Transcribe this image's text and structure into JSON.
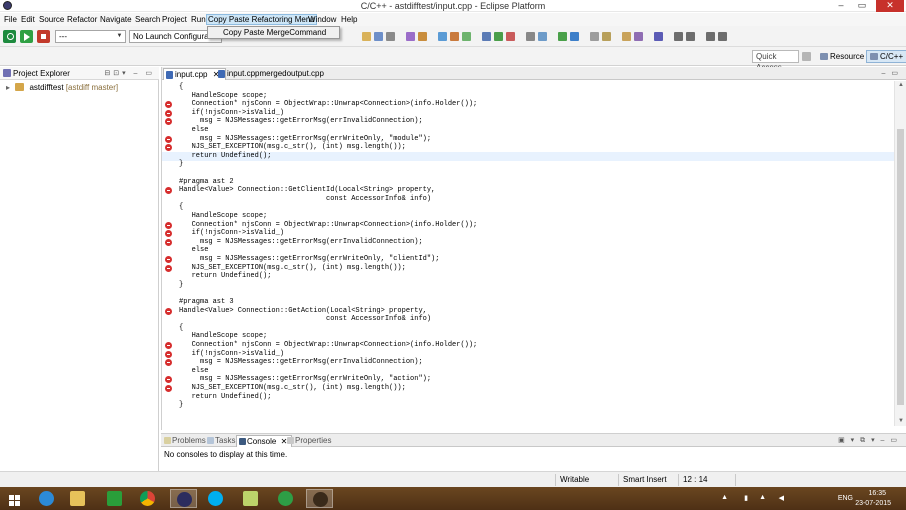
{
  "window": {
    "title": "C/C++ - astdifftest/input.cpp - Eclipse Platform"
  },
  "menu": {
    "items": [
      "File",
      "Edit",
      "Source",
      "Refactor",
      "Navigate",
      "Search",
      "Project",
      "Run",
      "Copy Paste Refactoring Menu",
      "Window",
      "Help"
    ],
    "open_menu_item": "Copy Paste MergeCommand"
  },
  "toolbar": {
    "launch_mode_value": "---",
    "launch_config_value": "No Launch Configuratio"
  },
  "toolbar2": {
    "quick_access": "Quick Access",
    "perspectives": [
      "Resource",
      "C/C++"
    ]
  },
  "explorer": {
    "title": "Project Explorer",
    "project": {
      "name": "astdifftest",
      "decoration": "[astdiff master]"
    }
  },
  "editor": {
    "tabs": [
      "input.cpp",
      "input.cppmergedoutput.cpp"
    ],
    "lines": [
      {
        "text": "{",
        "error": false
      },
      {
        "text": "   HandleScope scope;",
        "error": false
      },
      {
        "text": "   Connection* njsConn = ObjectWrap::Unwrap<Connection>(info.Holder());",
        "error": true
      },
      {
        "text": "   if(!njsConn->isValid_)",
        "error": true
      },
      {
        "text": "     msg = NJSMessages::getErrorMsg(errInvalidConnection);",
        "error": true
      },
      {
        "text": "   else",
        "error": false
      },
      {
        "text": "     msg = NJSMessages::getErrorMsg(errWriteOnly, \"module\");",
        "error": true
      },
      {
        "text": "   NJS_SET_EXCEPTION(msg.c_str(), (int) msg.length());",
        "error": true
      },
      {
        "text": "   return Undefined();",
        "error": false,
        "current": true
      },
      {
        "text": "}",
        "error": false
      },
      {
        "text": "",
        "error": false
      },
      {
        "text": "#pragma ast 2",
        "error": false
      },
      {
        "text": "Handle<Value> Connection::GetClientId(Local<String> property,",
        "error": true
      },
      {
        "text": "                                   const AccessorInfo& info)",
        "error": false
      },
      {
        "text": "{",
        "error": false
      },
      {
        "text": "   HandleScope scope;",
        "error": false
      },
      {
        "text": "   Connection* njsConn = ObjectWrap::Unwrap<Connection>(info.Holder());",
        "error": true
      },
      {
        "text": "   if(!njsConn->isValid_)",
        "error": true
      },
      {
        "text": "     msg = NJSMessages::getErrorMsg(errInvalidConnection);",
        "error": true
      },
      {
        "text": "   else",
        "error": false
      },
      {
        "text": "     msg = NJSMessages::getErrorMsg(errWriteOnly, \"clientId\");",
        "error": true
      },
      {
        "text": "   NJS_SET_EXCEPTION(msg.c_str(), (int) msg.length());",
        "error": true
      },
      {
        "text": "   return Undefined();",
        "error": false
      },
      {
        "text": "}",
        "error": false
      },
      {
        "text": "",
        "error": false
      },
      {
        "text": "#pragma ast 3",
        "error": false
      },
      {
        "text": "Handle<Value> Connection::GetAction(Local<String> property,",
        "error": true
      },
      {
        "text": "                                   const AccessorInfo& info)",
        "error": false
      },
      {
        "text": "{",
        "error": false
      },
      {
        "text": "   HandleScope scope;",
        "error": false
      },
      {
        "text": "   Connection* njsConn = ObjectWrap::Unwrap<Connection>(info.Holder());",
        "error": true
      },
      {
        "text": "   if(!njsConn->isValid_)",
        "error": true
      },
      {
        "text": "     msg = NJSMessages::getErrorMsg(errInvalidConnection);",
        "error": true
      },
      {
        "text": "   else",
        "error": false
      },
      {
        "text": "     msg = NJSMessages::getErrorMsg(errWriteOnly, \"action\");",
        "error": true
      },
      {
        "text": "   NJS_SET_EXCEPTION(msg.c_str(), (int) msg.length());",
        "error": true
      },
      {
        "text": "   return Undefined();",
        "error": false
      },
      {
        "text": "}",
        "error": false
      }
    ]
  },
  "bottom_panel": {
    "tabs": [
      "Problems",
      "Tasks",
      "Console",
      "Properties"
    ],
    "active_tab": "Console",
    "message": "No consoles to display at this time."
  },
  "status": {
    "mode": "Writable",
    "insert": "Smart Insert",
    "position": "12 : 14"
  },
  "taskbar": {
    "apps": [
      "start-button",
      "internet-explorer",
      "file-explorer",
      "store",
      "chrome",
      "eclipse",
      "skype",
      "photo-viewer",
      "hangouts",
      "game-app"
    ],
    "language": "ENG",
    "time": "16:35",
    "date": "23-07-2015"
  },
  "colors": {
    "error_marker": "#d62e2e",
    "keyword": "#7f0055",
    "string": "#2a00ff",
    "taskbar": "#5b3a1a"
  }
}
